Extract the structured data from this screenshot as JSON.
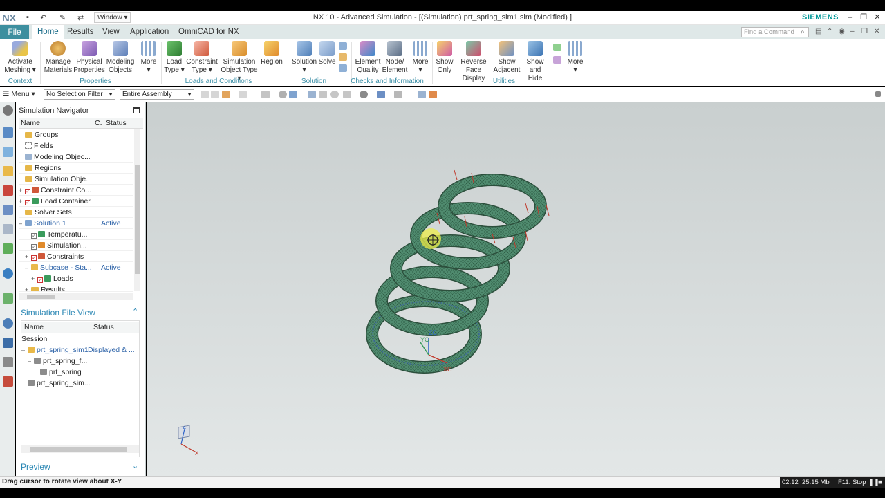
{
  "window": {
    "app_logo": "NX",
    "window_menu": "Window ▾",
    "title": "NX 10 - Advanced Simulation - [(Simulation) prt_spring_sim1.sim (Modified) ]",
    "brand": "SIEMENS"
  },
  "tabs": {
    "file": "File",
    "items": [
      "Home",
      "Results",
      "View",
      "Application",
      "OmniCAD for NX"
    ],
    "active": "Home",
    "find_placeholder": "Find a Command"
  },
  "ribbon": {
    "buttons": [
      {
        "label1": "Activate",
        "label2": "Meshing ▾",
        "icon": "meshing-icon"
      },
      {
        "label1": "Manage",
        "label2": "Materials",
        "icon": "materials-icon"
      },
      {
        "label1": "Physical",
        "label2": "Properties",
        "icon": "physical-properties-icon"
      },
      {
        "label1": "Modeling",
        "label2": "Objects",
        "icon": "modeling-objects-icon"
      },
      {
        "label1": "More",
        "label2": "▾",
        "icon": "more-icon"
      },
      {
        "label1": "Load",
        "label2": "Type ▾",
        "icon": "load-type-icon"
      },
      {
        "label1": "Constraint",
        "label2": "Type ▾",
        "icon": "constraint-type-icon"
      },
      {
        "label1": "Simulation",
        "label2": "Object Type ▾",
        "icon": "simulation-object-icon"
      },
      {
        "label1": "Region",
        "label2": "",
        "icon": "region-icon"
      },
      {
        "label1": "Solution",
        "label2": "▾",
        "icon": "solution-icon"
      },
      {
        "label1": "Solve",
        "label2": "",
        "icon": "solve-icon"
      },
      {
        "label1": "Element",
        "label2": "Quality",
        "icon": "element-quality-icon"
      },
      {
        "label1": "Node/",
        "label2": "Element",
        "icon": "node-element-icon"
      },
      {
        "label1": "More",
        "label2": "▾",
        "icon": "more-icon"
      },
      {
        "label1": "Show",
        "label2": "Only",
        "icon": "show-only-icon"
      },
      {
        "label1": "Reverse",
        "label2": "Face Display",
        "icon": "reverse-face-icon"
      },
      {
        "label1": "Show",
        "label2": "Adjacent",
        "icon": "show-adjacent-icon"
      },
      {
        "label1": "Show",
        "label2": "and Hide",
        "icon": "show-hide-icon"
      },
      {
        "label1": "More",
        "label2": "▾",
        "icon": "more-icon"
      }
    ],
    "groups": [
      "Context",
      "Properties",
      "Loads and Conditions",
      "Solution",
      "Checks and Information",
      "Utilities"
    ]
  },
  "toolbar": {
    "menu": "☰ Menu ▾",
    "selection_filter": "No Selection Filter",
    "assembly_scope": "Entire Assembly"
  },
  "navigator": {
    "title": "Simulation Navigator",
    "columns": [
      "Name",
      "C.",
      "Status"
    ],
    "rows": [
      {
        "label": "Groups",
        "status": ""
      },
      {
        "label": "Fields",
        "status": ""
      },
      {
        "label": "Modeling Objec...",
        "status": ""
      },
      {
        "label": "Regions",
        "status": ""
      },
      {
        "label": "Simulation Obje...",
        "status": ""
      },
      {
        "label": "Constraint Co...",
        "status": ""
      },
      {
        "label": "Load Container",
        "status": ""
      },
      {
        "label": "Solver Sets",
        "status": ""
      },
      {
        "label": "Solution 1",
        "status": "Active"
      },
      {
        "label": "Temperatu...",
        "status": ""
      },
      {
        "label": "Simulation...",
        "status": ""
      },
      {
        "label": "Constraints",
        "status": ""
      },
      {
        "label": "Subcase - Sta...",
        "status": "Active"
      },
      {
        "label": "Loads",
        "status": ""
      },
      {
        "label": "Results",
        "status": ""
      }
    ]
  },
  "file_view": {
    "title": "Simulation File View",
    "columns": [
      "Name",
      "Status"
    ],
    "rows": [
      {
        "label": "Session",
        "status": ""
      },
      {
        "label": "prt_spring_sim1",
        "status": "Displayed & ..."
      },
      {
        "label": "prt_spring_f...",
        "status": ""
      },
      {
        "label": "prt_spring",
        "status": ""
      },
      {
        "label": "prt_spring_sim...",
        "status": ""
      }
    ]
  },
  "preview": {
    "title": "Preview"
  },
  "viewport": {
    "triad_labels": {
      "zc": "ZC",
      "yc": "YC",
      "xc": "XC"
    },
    "view_triad": {
      "z": "Z",
      "x": "X"
    },
    "mesh_color": "#4f8a6e",
    "load_arrow_color": "#c0392b"
  },
  "status_bar": {
    "message": "Drag cursor to rotate view about X-Y",
    "time": "02:12",
    "memory": "25.15 Mb",
    "stop": "F11: Stop"
  }
}
